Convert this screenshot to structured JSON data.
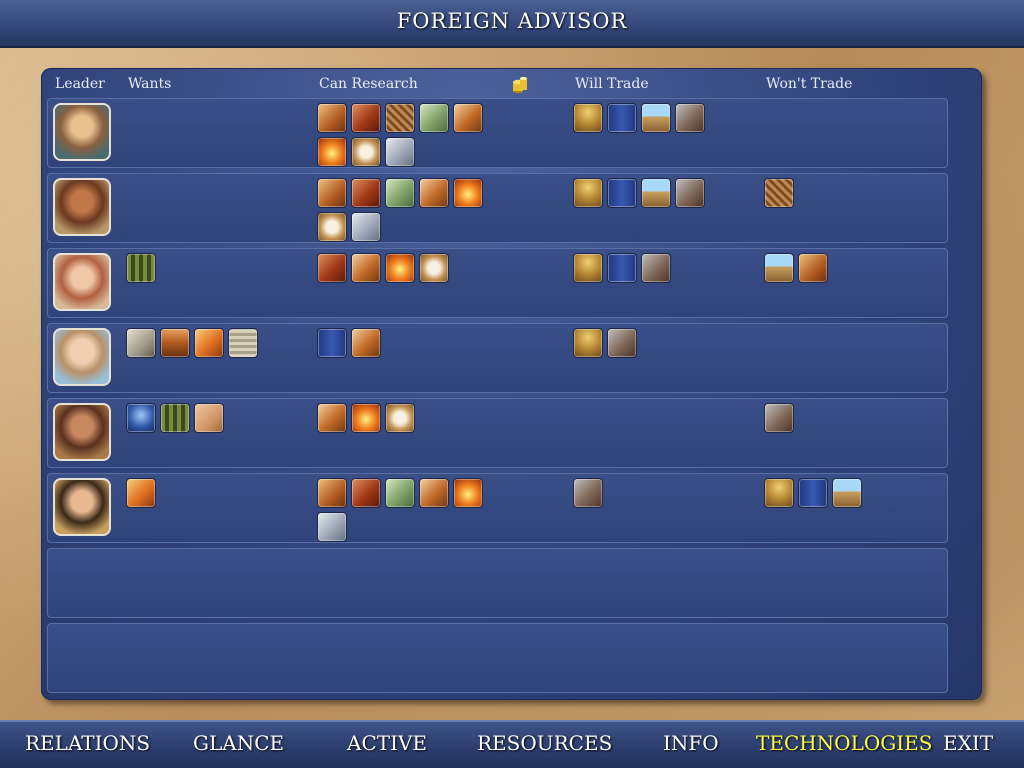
{
  "title": "FOREIGN ADVISOR",
  "columns": {
    "leader": "Leader",
    "wants": "Wants",
    "can_research": "Can Research",
    "will_trade": "Will Trade",
    "wont_trade": "Won't Trade"
  },
  "colors": {
    "panel": "#2f4279",
    "active_tab": "#ffff40",
    "tab_text": "#ffffff"
  },
  "leaders": [
    {
      "portrait": "leader-1-portrait",
      "wants": [],
      "can_research": [
        "horse-icon",
        "warrior-code-icon",
        "bronze-icon",
        "currency-icon",
        "horseback-icon",
        "iron-icon",
        "compass-icon",
        "wheel-icon"
      ],
      "will_trade": [
        "ceremonial-icon",
        "writing-icon",
        "masonry-icon",
        "stone-icon"
      ],
      "wont_trade": []
    },
    {
      "portrait": "leader-2-portrait",
      "wants": [],
      "can_research": [
        "horse-icon",
        "warrior-code-icon",
        "currency-icon",
        "horseback-icon",
        "iron-icon",
        "compass-icon",
        "wheel-icon"
      ],
      "will_trade": [
        "ceremonial-icon",
        "writing-icon",
        "masonry-icon",
        "stone-icon"
      ],
      "wont_trade": [
        "bronze-icon"
      ]
    },
    {
      "portrait": "leader-3-portrait",
      "wants": [
        "mathematics-icon"
      ],
      "can_research": [
        "warrior-code-icon",
        "horseback-icon",
        "iron-icon",
        "compass-icon"
      ],
      "will_trade": [
        "ceremonial-icon",
        "writing-icon",
        "stone-icon"
      ],
      "wont_trade": [
        "masonry-icon",
        "horse-icon"
      ]
    },
    {
      "portrait": "leader-4-portrait",
      "wants": [
        "philosophy-icon",
        "pottery-icon",
        "sailing-icon",
        "literature-icon"
      ],
      "can_research": [
        "writing-icon",
        "horseback-icon"
      ],
      "will_trade": [
        "ceremonial-icon",
        "stone-icon"
      ],
      "wont_trade": []
    },
    {
      "portrait": "leader-5-portrait",
      "wants": [
        "monarchy-icon",
        "mathematics-icon",
        "alphabet-icon"
      ],
      "can_research": [
        "horseback-icon",
        "iron-icon",
        "compass-icon"
      ],
      "will_trade": [],
      "wont_trade": [
        "stone-icon"
      ]
    },
    {
      "portrait": "leader-6-portrait",
      "wants": [
        "sailing-icon"
      ],
      "can_research": [
        "horse-icon",
        "warrior-code-icon",
        "currency-icon",
        "horseback-icon",
        "iron-icon",
        "wheel-icon"
      ],
      "will_trade": [
        "stone-icon"
      ],
      "wont_trade": [
        "ceremonial-icon",
        "writing-icon",
        "masonry-icon"
      ]
    }
  ],
  "tabs": [
    {
      "label": "RELATIONS",
      "active": false
    },
    {
      "label": "GLANCE",
      "active": false
    },
    {
      "label": "ACTIVE",
      "active": false
    },
    {
      "label": "RESOURCES",
      "active": false
    },
    {
      "label": "INFO",
      "active": false
    },
    {
      "label": "TECHNOLOGIES",
      "active": true
    },
    {
      "label": "EXIT",
      "active": false
    }
  ]
}
